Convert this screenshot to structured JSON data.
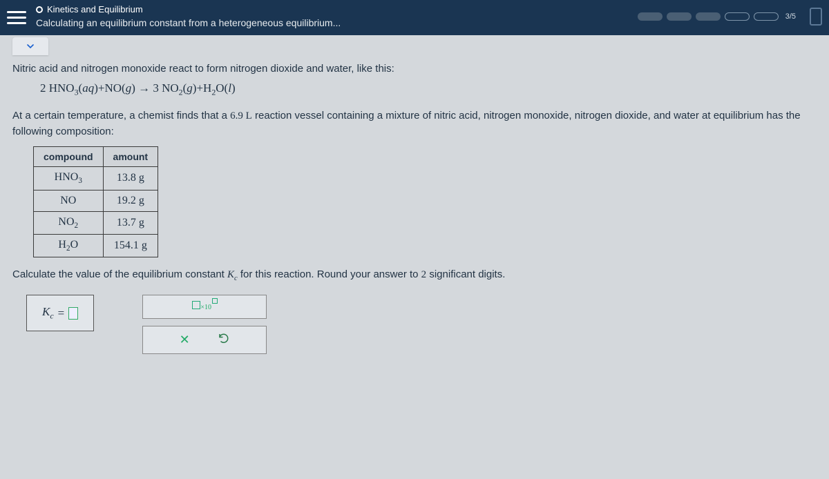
{
  "header": {
    "breadcrumb1": "Kinetics and Equilibrium",
    "breadcrumb2": "Calculating an equilibrium constant from a heterogeneous equilibrium...",
    "progress": "3/5"
  },
  "problem": {
    "intro": "Nitric acid and nitrogen monoxide react to form nitrogen dioxide and water, like this:",
    "equation": "2 HNO₃(aq) + NO(g) → 3 NO₂(g) + H₂O(l)",
    "setup_a": "At a certain temperature, a chemist finds that a ",
    "setup_vol": "6.9 L",
    "setup_b": " reaction vessel containing a mixture of nitric acid, nitrogen monoxide, nitrogen dioxide, and water at equilibrium has the following composition:",
    "table": {
      "headers": {
        "c1": "compound",
        "c2": "amount"
      },
      "rows": [
        {
          "compound": "HNO₃",
          "amount": "13.8 g"
        },
        {
          "compound": "NO",
          "amount": "19.2 g"
        },
        {
          "compound": "NO₂",
          "amount": "13.7 g"
        },
        {
          "compound": "H₂O",
          "amount": "154.1 g"
        }
      ]
    },
    "prompt_a": "Calculate the value of the equilibrium constant ",
    "prompt_sym": "K𝑐",
    "prompt_b": " for this reaction. Round your answer to ",
    "prompt_sig": "2",
    "prompt_c": " significant digits."
  },
  "answer": {
    "label": "K",
    "sub": "c",
    "equals": " = ",
    "x10": "×10"
  },
  "buttons": {
    "clear": "✕"
  }
}
